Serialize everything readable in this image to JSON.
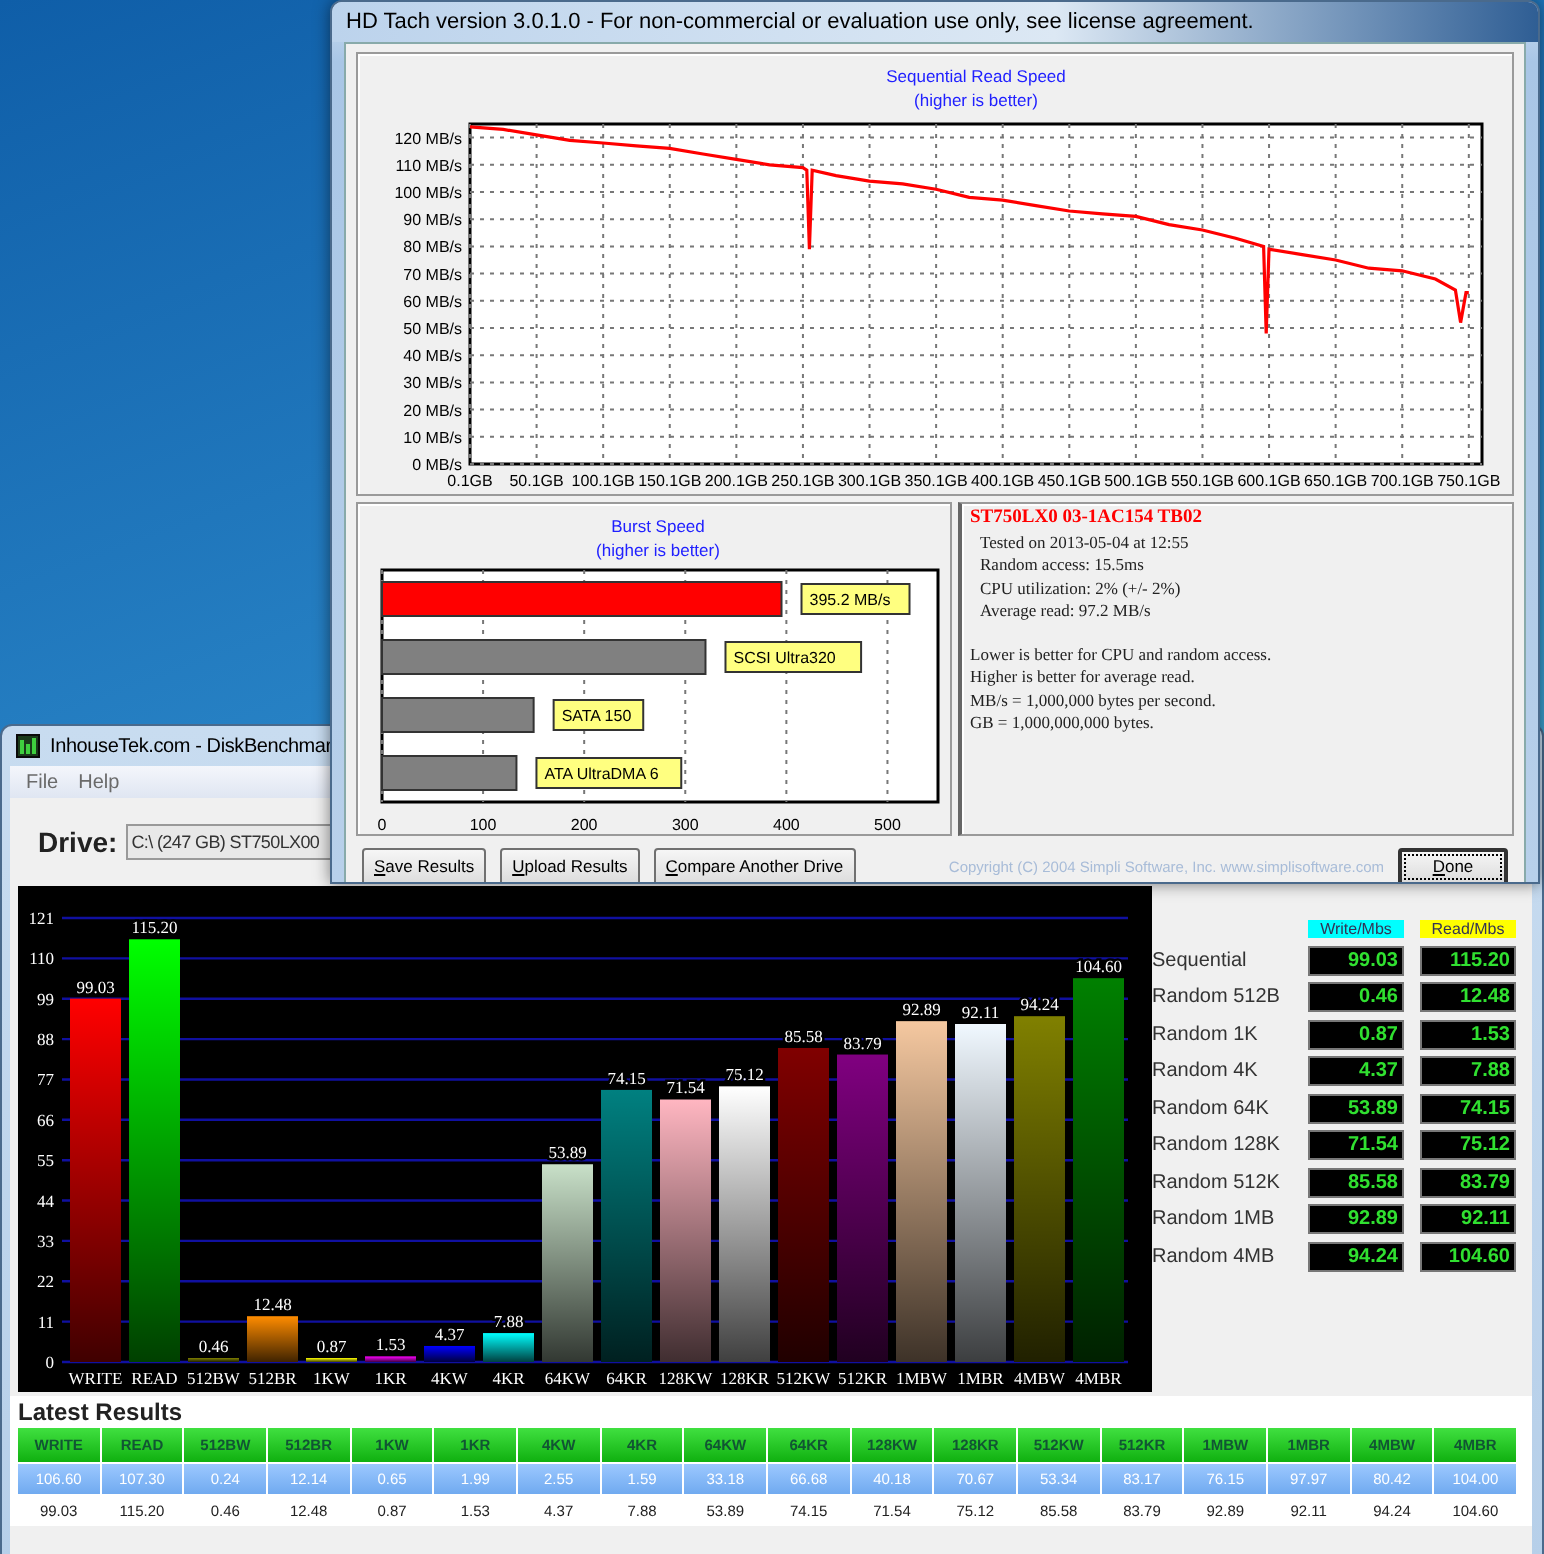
{
  "hd_tach": {
    "title": "HD Tach version 3.0.1.0  - For non-commercial or evaluation use only, see license agreement.",
    "read_chart": {
      "subtitle": "(higher is better)",
      "chart_data": {
        "type": "line",
        "title": "Sequential Read Speed",
        "x": [
          0.1,
          25,
          50,
          75,
          100,
          125,
          150,
          175,
          200,
          225,
          250,
          253,
          255,
          257,
          275,
          300,
          325,
          350,
          375,
          400,
          425,
          450,
          475,
          500,
          525,
          550,
          575,
          596,
          598,
          600,
          625,
          650,
          675,
          700,
          725,
          740,
          744,
          748,
          750.1
        ],
        "series": [
          {
            "color": "#ff0000",
            "values": [
              124,
              123,
              121,
              119,
              118,
              117,
              116,
              114,
              112,
              110,
              109,
              108,
              79,
              108,
              106,
              104,
              103,
              101,
              98,
              97,
              95,
              93,
              92,
              91,
              88,
              86,
              83,
              80,
              48,
              79,
              77,
              75,
              72,
              71,
              68,
              64,
              52,
              63,
              63
            ]
          }
        ],
        "xlim": [
          0.1,
          760
        ],
        "ylim": [
          0,
          125
        ],
        "grid": true,
        "xticks": [
          {
            "value": 0.1,
            "label": "0.1GB"
          },
          {
            "value": 50.1,
            "label": "50.1GB"
          },
          {
            "value": 100.1,
            "label": "100.1GB"
          },
          {
            "value": 150.1,
            "label": "150.1GB"
          },
          {
            "value": 200.1,
            "label": "200.1GB"
          },
          {
            "value": 250.1,
            "label": "250.1GB"
          },
          {
            "value": 300.1,
            "label": "300.1GB"
          },
          {
            "value": 350.1,
            "label": "350.1GB"
          },
          {
            "value": 400.1,
            "label": "400.1GB"
          },
          {
            "value": 450.1,
            "label": "450.1GB"
          },
          {
            "value": 500.1,
            "label": "500.1GB"
          },
          {
            "value": 550.1,
            "label": "550.1GB"
          },
          {
            "value": 600.1,
            "label": "600.1GB"
          },
          {
            "value": 650.1,
            "label": "650.1GB"
          },
          {
            "value": 700.1,
            "label": "700.1GB"
          },
          {
            "value": 750.1,
            "label": "750.1GB"
          }
        ],
        "yticks": [
          {
            "value": 0,
            "label": "0 MB/s"
          },
          {
            "value": 10,
            "label": "10 MB/s"
          },
          {
            "value": 20,
            "label": "20 MB/s"
          },
          {
            "value": 30,
            "label": "30 MB/s"
          },
          {
            "value": 40,
            "label": "40 MB/s"
          },
          {
            "value": 50,
            "label": "50 MB/s"
          },
          {
            "value": 60,
            "label": "60 MB/s"
          },
          {
            "value": 70,
            "label": "70 MB/s"
          },
          {
            "value": 80,
            "label": "80 MB/s"
          },
          {
            "value": 90,
            "label": "90 MB/s"
          },
          {
            "value": 100,
            "label": "100 MB/s"
          },
          {
            "value": 110,
            "label": "110 MB/s"
          },
          {
            "value": 120,
            "label": "120 MB/s"
          }
        ]
      }
    },
    "burst_chart": {
      "subtitle": "(higher is better)",
      "chart_data": {
        "type": "bar",
        "orientation": "horizontal",
        "title": "Burst Speed",
        "categories": [
          "395.2 MB/s",
          "SCSI Ultra320",
          "SATA 150",
          "ATA UltraDMA 6"
        ],
        "series": [
          {
            "color": "#ff0000",
            "values": [
              395.2,
              null,
              null,
              null
            ]
          },
          {
            "color": "#808080",
            "values": [
              null,
              320,
              150,
              133
            ]
          }
        ],
        "xlim": [
          0,
          550
        ],
        "xticks": [
          0,
          100,
          200,
          300,
          400,
          500
        ],
        "grid": true
      }
    },
    "drive_info": {
      "model": "ST750LX0 03-1AC154  TB02",
      "details": [
        "Tested on 2013-05-04 at 12:55",
        "Random access: 15.5ms",
        "CPU utilization: 2% (+/- 2%)",
        "Average read: 97.2 MB/s"
      ],
      "notes": [
        "Lower is better for CPU and random access.",
        "Higher is better for average read.",
        "MB/s = 1,000,000 bytes per second.",
        "GB = 1,000,000,000 bytes."
      ]
    },
    "buttons": [
      {
        "label": "Save Results"
      },
      {
        "label": "Upload Results"
      },
      {
        "label": "Compare Another Drive"
      }
    ],
    "copyright": "Copyright (C) 2004 Simpli Software, Inc. www.simplisoftware.com",
    "done_button": {
      "label": "Done"
    }
  },
  "diskbenchmark": {
    "title": "InhouseTek.com - DiskBenchmar",
    "menu": [
      "File",
      "Help"
    ],
    "drive_label": "Drive:",
    "drive_value": "C:\\ (247 GB) ST750LX00",
    "chart": {
      "chart_data": {
        "type": "bar",
        "categories": [
          "WRITE",
          "READ",
          "512BW",
          "512BR",
          "1KW",
          "1KR",
          "4KW",
          "4KR",
          "64KW",
          "64KR",
          "128KW",
          "128KR",
          "512KW",
          "512KR",
          "1MBW",
          "1MBR",
          "4MBW",
          "4MBR"
        ],
        "values": [
          99.03,
          115.2,
          0.46,
          12.48,
          0.87,
          1.53,
          4.37,
          7.88,
          53.89,
          74.15,
          71.54,
          75.12,
          85.58,
          83.79,
          92.89,
          92.11,
          94.24,
          104.6
        ],
        "value_labels": [
          "99.03",
          "115.20",
          "0.46",
          "12.48",
          "0.87",
          "1.53",
          "4.37",
          "7.88",
          "53.89",
          "74.15",
          "71.54",
          "75.12",
          "85.58",
          "83.79",
          "92.89",
          "92.11",
          "94.24",
          "104.60"
        ],
        "ylim": [
          0,
          121
        ],
        "yticks": [
          0,
          11,
          22,
          33,
          44,
          55,
          66,
          77,
          88,
          99,
          110,
          121
        ],
        "grid": true
      }
    },
    "summary": {
      "columns": [
        {
          "label": "Write/Mbs",
          "color": "#00ffff"
        },
        {
          "label": "Read/Mbs",
          "color": "#ffff00"
        }
      ],
      "rows": [
        {
          "label": "Sequential",
          "write": "99.03",
          "read": "115.20"
        },
        {
          "label": "Random 512B",
          "write": "0.46",
          "read": "12.48"
        },
        {
          "label": "Random 1K",
          "write": "0.87",
          "read": "1.53"
        },
        {
          "label": "Random 4K",
          "write": "4.37",
          "read": "7.88"
        },
        {
          "label": "Random 64K",
          "write": "53.89",
          "read": "74.15"
        },
        {
          "label": "Random 128K",
          "write": "71.54",
          "read": "75.12"
        },
        {
          "label": "Random 512K",
          "write": "85.58",
          "read": "83.79"
        },
        {
          "label": "Random 1MB",
          "write": "92.89",
          "read": "92.11"
        },
        {
          "label": "Random 4MB",
          "write": "94.24",
          "read": "104.60"
        }
      ]
    },
    "latest_results": {
      "heading": "Latest Results",
      "columns": [
        "WRITE",
        "READ",
        "512BW",
        "512BR",
        "1KW",
        "1KR",
        "4KW",
        "4KR",
        "64KW",
        "64KR",
        "128KW",
        "128KR",
        "512KW",
        "512KR",
        "1MBW",
        "1MBR",
        "4MBW",
        "4MBR"
      ],
      "rows": [
        {
          "selected": true,
          "cells": [
            "106.60",
            "107.30",
            "0.24",
            "12.14",
            "0.65",
            "1.99",
            "2.55",
            "1.59",
            "33.18",
            "66.68",
            "40.18",
            "70.67",
            "53.34",
            "83.17",
            "76.15",
            "97.97",
            "80.42",
            "104.00"
          ]
        },
        {
          "selected": false,
          "cells": [
            "99.03",
            "115.20",
            "0.46",
            "12.48",
            "0.87",
            "1.53",
            "4.37",
            "7.88",
            "53.89",
            "74.15",
            "71.54",
            "75.12",
            "85.58",
            "83.79",
            "92.89",
            "92.11",
            "94.24",
            "104.60"
          ]
        }
      ]
    }
  }
}
